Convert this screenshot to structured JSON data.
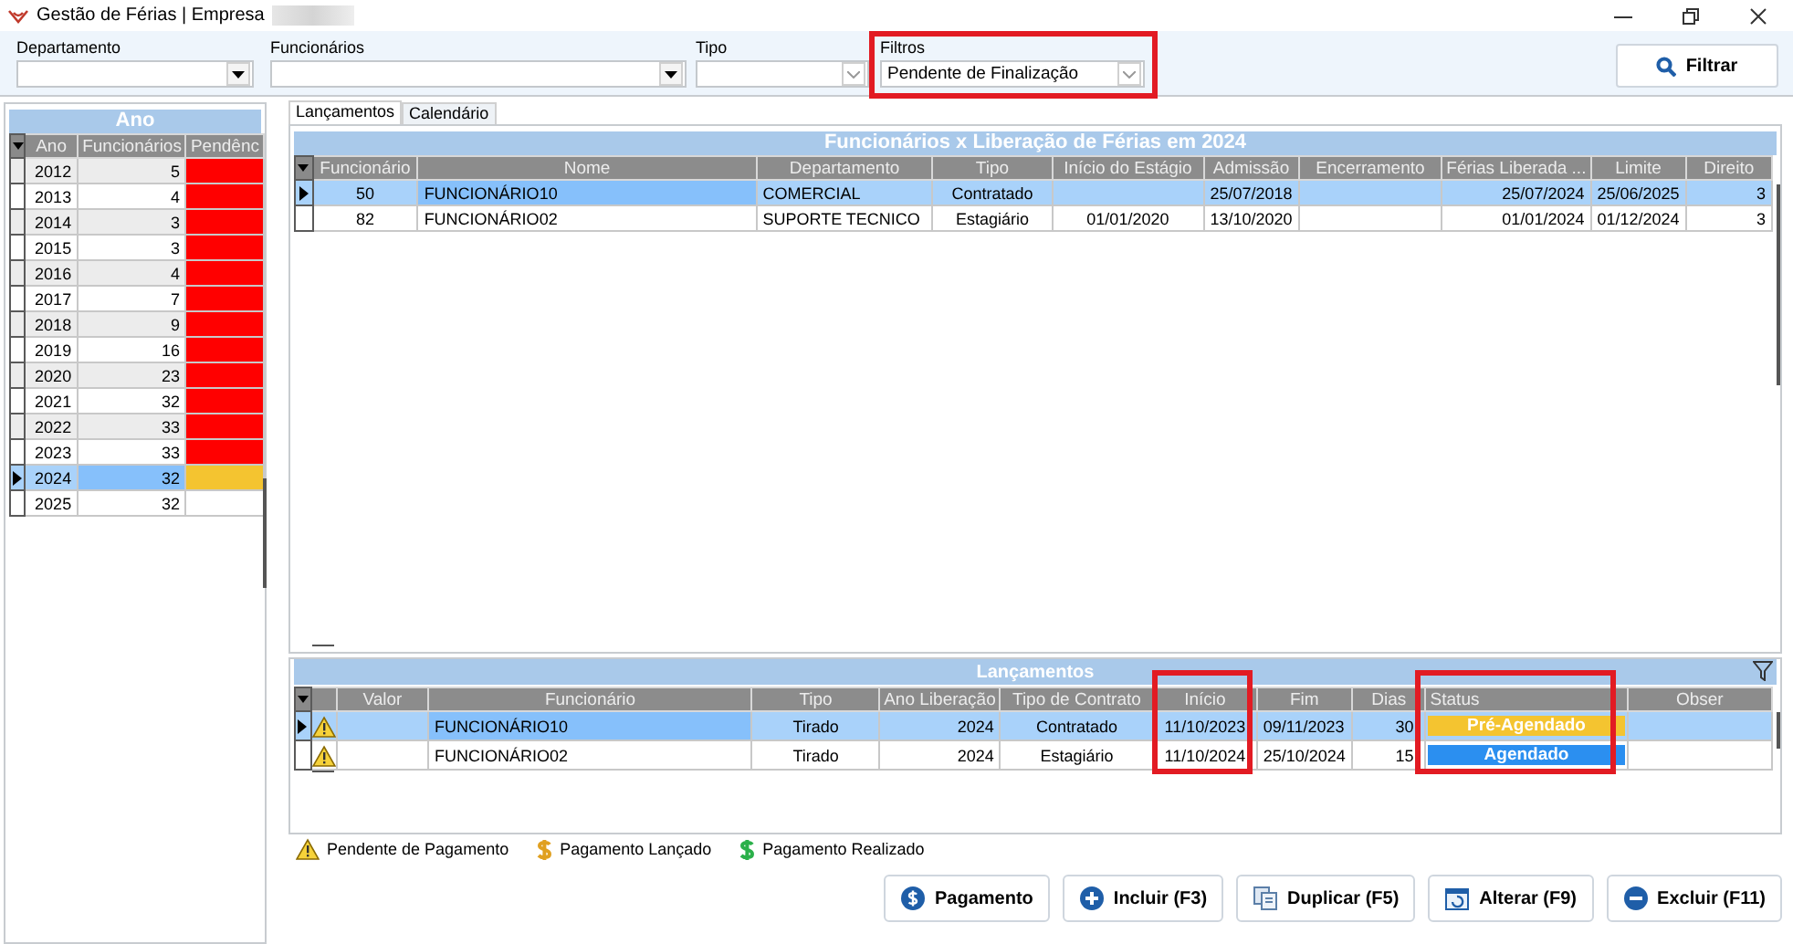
{
  "window": {
    "title": "Gestão de Férias | Empresa"
  },
  "filters": [
    {
      "label": "Departamento",
      "kind": "dropdown"
    },
    {
      "label": "Funcionários",
      "kind": "dropdown"
    },
    {
      "label": "Tipo",
      "kind": "combo"
    },
    {
      "label": "Filtros",
      "kind": "combo",
      "value": "Pendente de Finalização",
      "highlighted": true
    }
  ],
  "filter_button": "Filtrar",
  "year_panel": {
    "title": "Ano",
    "columns": [
      "Ano",
      "Funcionários",
      "Pendênc"
    ],
    "rows": [
      {
        "year": "2012",
        "count": "5",
        "color": "#ff0000",
        "selected": false
      },
      {
        "year": "2013",
        "count": "4",
        "color": "#ff0000",
        "selected": false
      },
      {
        "year": "2014",
        "count": "3",
        "color": "#ff0000",
        "selected": false
      },
      {
        "year": "2015",
        "count": "3",
        "color": "#ff0000",
        "selected": false
      },
      {
        "year": "2016",
        "count": "4",
        "color": "#ff0000",
        "selected": false
      },
      {
        "year": "2017",
        "count": "7",
        "color": "#ff0000",
        "selected": false
      },
      {
        "year": "2018",
        "count": "9",
        "color": "#ff0000",
        "selected": false
      },
      {
        "year": "2019",
        "count": "16",
        "color": "#ff0000",
        "selected": false
      },
      {
        "year": "2020",
        "count": "23",
        "color": "#ff0000",
        "selected": false
      },
      {
        "year": "2021",
        "count": "32",
        "color": "#ff0000",
        "selected": false
      },
      {
        "year": "2022",
        "count": "33",
        "color": "#ff0000",
        "selected": false
      },
      {
        "year": "2023",
        "count": "33",
        "color": "#ff0000",
        "selected": false
      },
      {
        "year": "2024",
        "count": "32",
        "color": "#f4c430",
        "selected": true
      },
      {
        "year": "2025",
        "count": "32",
        "color": "#ffffff",
        "selected": false
      }
    ]
  },
  "tabs": [
    {
      "label": "Lançamentos",
      "selected": true
    },
    {
      "label": "Calendário",
      "selected": false
    }
  ],
  "employees_panel": {
    "title": "Funcionários x Liberação de Férias em 2024",
    "columns": [
      "Funcionário",
      "Nome",
      "Departamento",
      "Tipo",
      "Início do Estágio",
      "Admissão",
      "Encerramento",
      "Férias Liberada ...",
      "Limite",
      "Direito"
    ],
    "rows": [
      {
        "selected": true,
        "cells": [
          "50",
          "FUNCIONÁRIO10",
          "COMERCIAL",
          "Contratado",
          null,
          "25/07/2018",
          null,
          "25/07/2024",
          "25/06/2025",
          "3"
        ]
      },
      {
        "selected": false,
        "cells": [
          "82",
          "FUNCIONÁRIO02",
          "SUPORTE TECNICO",
          "Estagiário",
          "01/01/2020",
          "13/10/2020",
          null,
          "01/01/2024",
          "01/12/2024",
          "3"
        ]
      }
    ]
  },
  "entries_panel": {
    "title": "Lançamentos",
    "columns": [
      {
        "label": "Valor",
        "highlighted": false
      },
      {
        "label": "Funcionário",
        "highlighted": false
      },
      {
        "label": "Tipo",
        "highlighted": false
      },
      {
        "label": "Ano Liberação",
        "highlighted": false
      },
      {
        "label": "Tipo de Contrato",
        "highlighted": false
      },
      {
        "label": "Início",
        "highlighted": true
      },
      {
        "label": "Fim",
        "highlighted": false
      },
      {
        "label": "Dias",
        "highlighted": false
      },
      {
        "label": "Status",
        "highlighted": true
      },
      {
        "label": "Obser",
        "highlighted": false
      }
    ],
    "rows": [
      {
        "selected": true,
        "kind": "warning",
        "cells": [
          "",
          "FUNCIONÁRIO10",
          "Tirado",
          "2024",
          "Contratado",
          "11/10/2023",
          "09/11/2023",
          "30"
        ],
        "status": {
          "label": "Pré-Agendado",
          "color": "#f4c430"
        }
      },
      {
        "selected": false,
        "kind": "warning",
        "cells": [
          "",
          "FUNCIONÁRIO02",
          "Tirado",
          "2024",
          "Estagiário",
          "11/10/2024",
          "25/10/2024",
          "15"
        ],
        "status": {
          "label": "Agendado",
          "color": "#2b8ff0"
        }
      }
    ]
  },
  "legend": [
    {
      "kind": "warning",
      "label": "Pendente de Pagamento"
    },
    {
      "kind": "dollar",
      "color": "#e0a020",
      "label": "Pagamento Lançado"
    },
    {
      "kind": "dollar",
      "color": "#2bb04a",
      "label": "Pagamento Realizado"
    }
  ],
  "buttons": [
    {
      "label": "Pagamento",
      "kind": "dollar"
    },
    {
      "label": "Incluir (F3)",
      "kind": "plus"
    },
    {
      "label": "Duplicar (F5)",
      "kind": "copy"
    },
    {
      "label": "Alterar (F9)",
      "kind": "refresh"
    },
    {
      "label": "Excluir (F11)",
      "kind": "minus"
    }
  ]
}
